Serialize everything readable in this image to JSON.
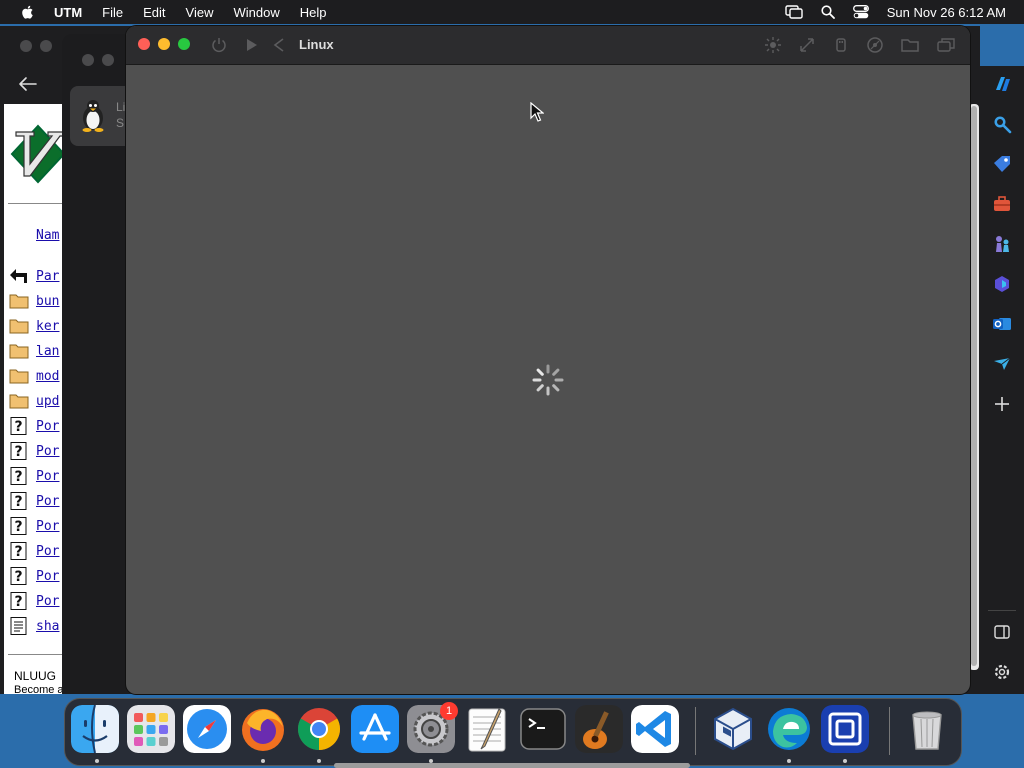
{
  "menubar": {
    "app_name": "UTM",
    "menus": [
      "File",
      "Edit",
      "View",
      "Window",
      "Help"
    ],
    "datetime": "Sun Nov 26  6:12 AM"
  },
  "browser": {
    "column_header": "Nam",
    "rows": [
      {
        "icon": "parent-dir-icon",
        "label": "Par"
      },
      {
        "icon": "folder-icon",
        "label": "bun"
      },
      {
        "icon": "folder-icon",
        "label": "ker"
      },
      {
        "icon": "folder-icon",
        "label": "lan"
      },
      {
        "icon": "folder-icon",
        "label": "mod"
      },
      {
        "icon": "folder-icon",
        "label": "upd"
      },
      {
        "icon": "unknown-file-icon",
        "label": "Por"
      },
      {
        "icon": "unknown-file-icon",
        "label": "Por"
      },
      {
        "icon": "unknown-file-icon",
        "label": "Por"
      },
      {
        "icon": "unknown-file-icon",
        "label": "Por"
      },
      {
        "icon": "unknown-file-icon",
        "label": "Por"
      },
      {
        "icon": "unknown-file-icon",
        "label": "Por"
      },
      {
        "icon": "unknown-file-icon",
        "label": "Por"
      },
      {
        "icon": "unknown-file-icon",
        "label": "Por"
      },
      {
        "icon": "text-file-icon",
        "label": "sha"
      }
    ],
    "footer_line1": "NLUUG",
    "footer_line2": "Become a member"
  },
  "utm_library": {
    "vm_name": "Li",
    "vm_status": "S"
  },
  "vm_window": {
    "title": "Linux"
  },
  "dock": {
    "apps": [
      "Finder",
      "Launchpad",
      "Safari",
      "Firefox",
      "Chrome",
      "App Store",
      "System Settings",
      "TextEdit",
      "Terminal",
      "GarageBand",
      "Visual Studio Code",
      "VirtualBox",
      "Edge",
      "UTM",
      "Trash"
    ],
    "system_settings_badge": "1"
  },
  "colors": {
    "close": "#ff5f57",
    "minimize": "#febc2e",
    "maximize": "#28c840",
    "link": "#1a0dab",
    "badge": "#ff3b30"
  }
}
